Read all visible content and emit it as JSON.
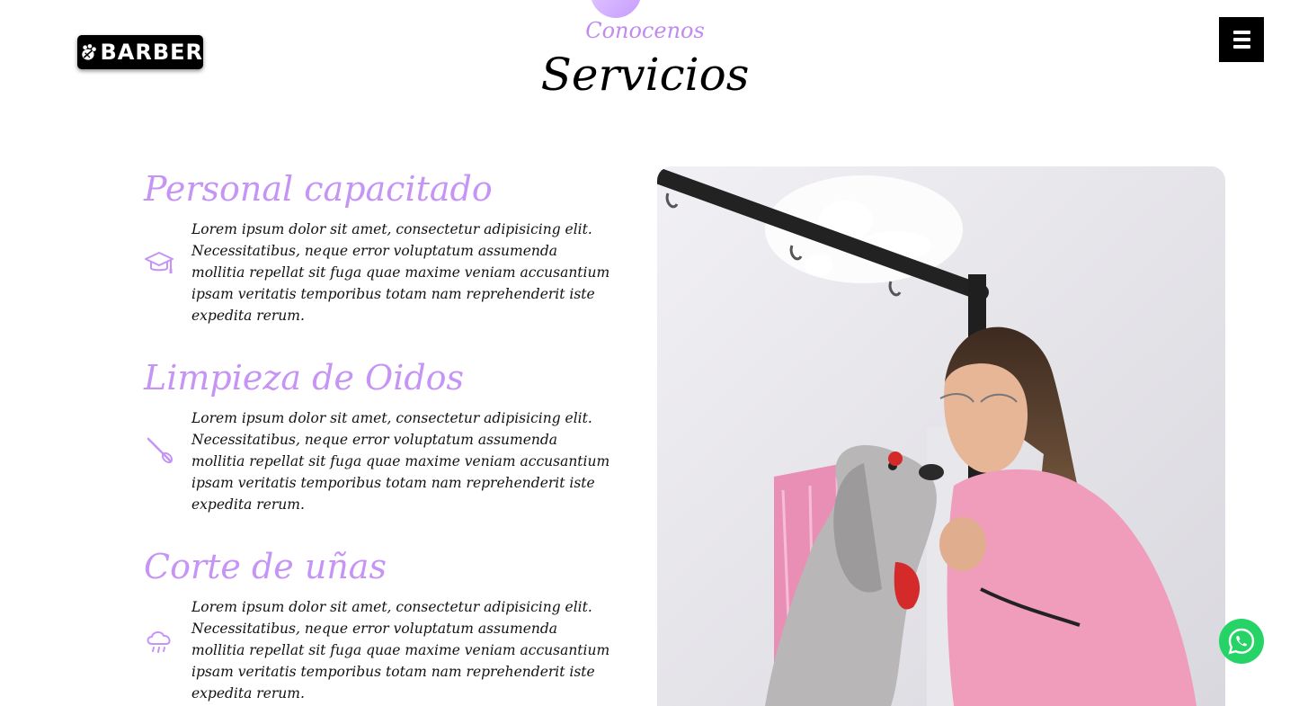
{
  "header": {
    "logo_text": "BARBER",
    "menu_icon": "bars-icon"
  },
  "hero": {
    "subtitle": "Conocenos",
    "title": "Servicios"
  },
  "services": [
    {
      "title": "Personal capacitado",
      "icon": "graduation-cap-icon",
      "text": "Lorem ipsum dolor sit amet, consectetur adipisicing elit. Necessitatibus, neque error voluptatum assumenda mollitia repellat sit fuga quae maxime veniam accusantium ipsam veritatis temporibus totam nam reprehenderit iste expedita rerum."
    },
    {
      "title": "Limpieza de Oidos",
      "icon": "ear-swab-icon",
      "text": "Lorem ipsum dolor sit amet, consectetur adipisicing elit. Necessitatibus, neque error voluptatum assumenda mollitia repellat sit fuga quae maxime veniam accusantium ipsam veritatis temporibus totam nam reprehenderit iste expedita rerum."
    },
    {
      "title": "Corte de uñas",
      "icon": "cloud-rain-icon",
      "text": "Lorem ipsum dolor sit amet, consectetur adipisicing elit. Necessitatibus, neque error voluptatum assumenda mollitia repellat sit fuga quae maxime veniam accusantium ipsam veritatis temporibus totam nam reprehenderit iste expedita rerum."
    }
  ],
  "photo": {
    "alt": "groomer-with-dog-photo"
  },
  "floating": {
    "whatsapp_icon": "whatsapp-icon"
  },
  "colors": {
    "accent": "#c594f5",
    "accent_dark": "#c08af0",
    "header_button": "#000000",
    "whatsapp": "#25d366"
  }
}
